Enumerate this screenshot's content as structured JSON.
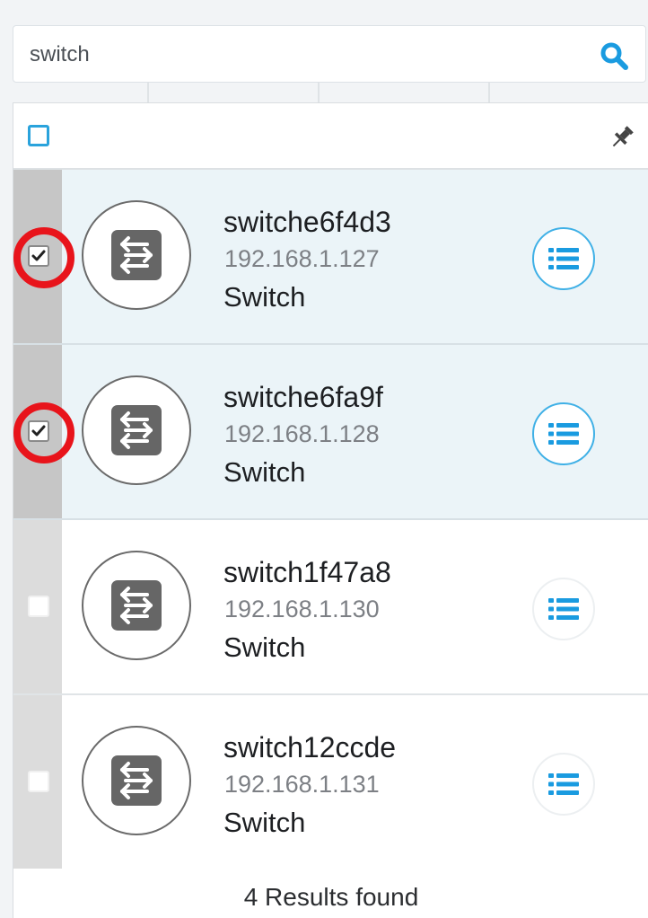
{
  "search": {
    "value": "switch"
  },
  "devices": [
    {
      "name": "switche6f4d3",
      "ip": "192.168.1.127",
      "type": "Switch",
      "checked": true,
      "highlighted": true
    },
    {
      "name": "switche6fa9f",
      "ip": "192.168.1.128",
      "type": "Switch",
      "checked": true,
      "highlighted": true
    },
    {
      "name": "switch1f47a8",
      "ip": "192.168.1.130",
      "type": "Switch",
      "checked": false,
      "highlighted": false
    },
    {
      "name": "switch12ccde",
      "ip": "192.168.1.131",
      "type": "Switch",
      "checked": false,
      "highlighted": false
    }
  ],
  "footer": {
    "results_text": "4 Results found"
  },
  "icons": {
    "search": "search-icon",
    "pin": "pin-icon",
    "device": "switch-icon",
    "details": "list-icon",
    "check": "checkmark-icon"
  },
  "colors": {
    "accent": "#2aa3dc",
    "highlight_ring": "#e8141b",
    "selected_row": "#ebf4f8"
  }
}
